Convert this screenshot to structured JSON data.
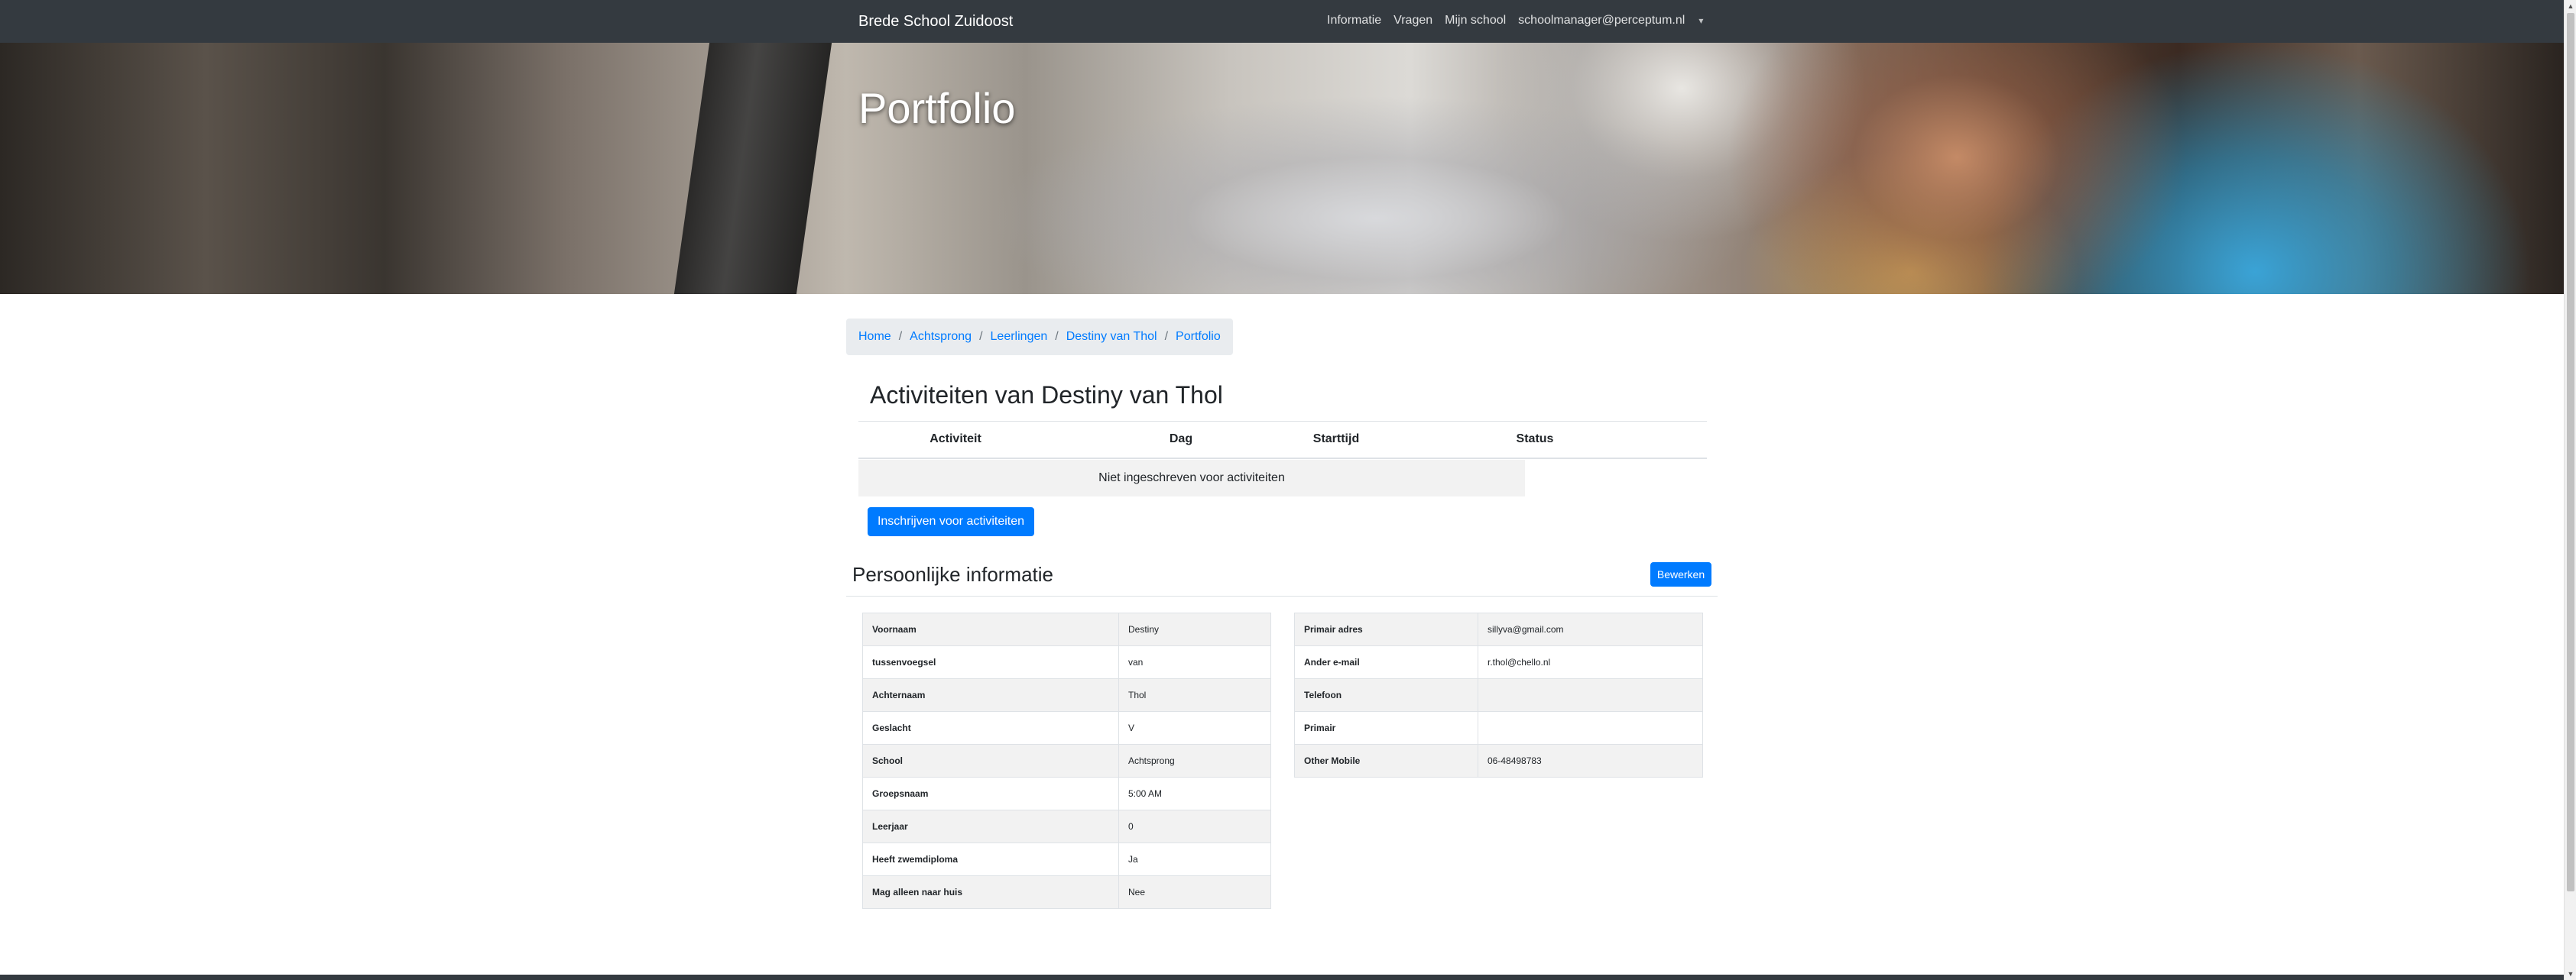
{
  "navbar": {
    "brand": "Brede School Zuidoost",
    "links": [
      "Informatie",
      "Vragen",
      "Mijn school",
      "schoolmanager@perceptum.nl"
    ],
    "caret": "▾"
  },
  "hero": {
    "title": "Portfolio"
  },
  "breadcrumb": {
    "items": [
      "Home",
      "Achtsprong",
      "Leerlingen",
      "Destiny van Thol",
      "Portfolio"
    ],
    "separator": "/"
  },
  "activities": {
    "title": "Activiteiten van Destiny van Thol",
    "headers": [
      "Activiteit",
      "Dag",
      "Starttijd",
      "Status"
    ],
    "empty_message": "Niet ingeschreven voor activiteiten",
    "subscribe_label": "Inschrijven voor activiteiten"
  },
  "personal": {
    "title": "Persoonlijke informatie",
    "edit_label": "Bewerken",
    "left": [
      {
        "label": "Voornaam",
        "value": "Destiny"
      },
      {
        "label": "tussenvoegsel",
        "value": "van"
      },
      {
        "label": "Achternaam",
        "value": "Thol"
      },
      {
        "label": "Geslacht",
        "value": "V"
      },
      {
        "label": "School",
        "value": "Achtsprong"
      },
      {
        "label": "Groepsnaam",
        "value": "5:00 AM"
      },
      {
        "label": "Leerjaar",
        "value": "0"
      },
      {
        "label": "Heeft zwemdiploma",
        "value": "Ja"
      },
      {
        "label": "Mag alleen naar huis",
        "value": "Nee"
      }
    ],
    "right": [
      {
        "label": "Primair adres",
        "value": "sillyva@gmail.com"
      },
      {
        "label": "Ander e-mail",
        "value": "r.thol@chello.nl"
      },
      {
        "label": "Telefoon",
        "value": ""
      },
      {
        "label": "Primair",
        "value": ""
      },
      {
        "label": "Other Mobile",
        "value": "06-48498783"
      }
    ]
  },
  "colors": {
    "navbar": "#343a40",
    "primary": "#007bff",
    "breadcrumb_bg": "#e9ecef",
    "stripe": "#f2f2f2"
  }
}
